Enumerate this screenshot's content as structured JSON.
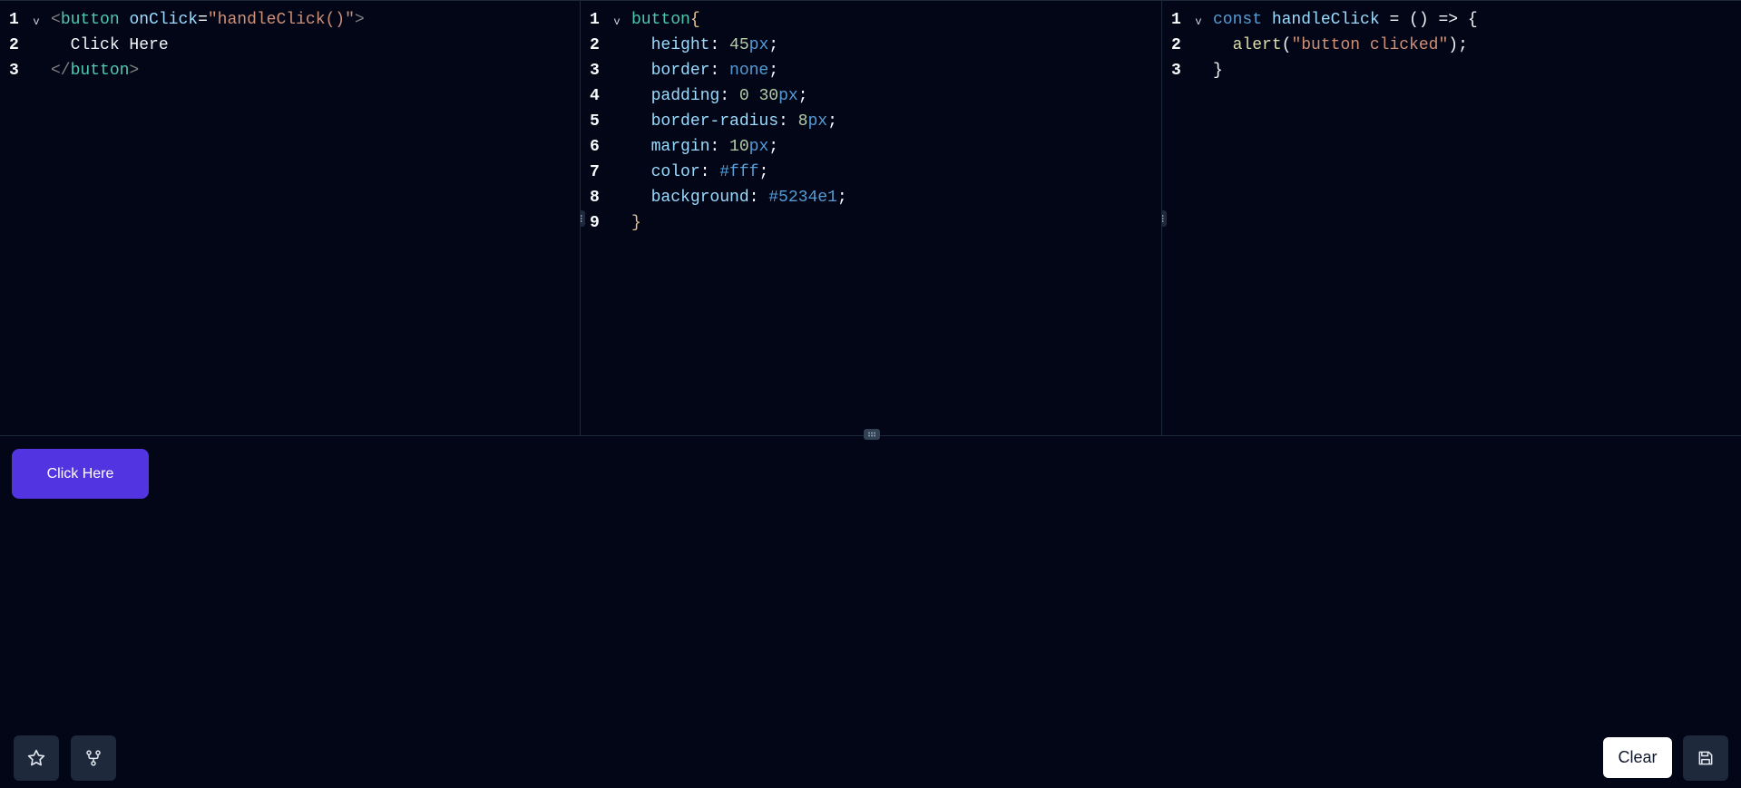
{
  "editors": {
    "html": {
      "line_numbers": [
        "1",
        "2",
        "3"
      ],
      "line1": {
        "open": "<",
        "tag": "button",
        "attr": "onClick",
        "eq": "=",
        "value": "\"handleClick()\"",
        "close": ">"
      },
      "line2": {
        "text": "Click Here"
      },
      "line3": {
        "open": "</",
        "tag": "button",
        "close": ">"
      }
    },
    "css": {
      "line_numbers": [
        "1",
        "2",
        "3",
        "4",
        "5",
        "6",
        "7",
        "8",
        "9"
      ],
      "selector": "button",
      "open_brace": "{",
      "close_brace": "}",
      "declarations": [
        {
          "prop": "height",
          "num": "45",
          "unit": "px",
          "kw": ""
        },
        {
          "prop": "border",
          "num": "",
          "unit": "",
          "kw": "none"
        },
        {
          "prop": "padding",
          "num": "0 30",
          "unit": "px",
          "kw": ""
        },
        {
          "prop": "border-radius",
          "num": "8",
          "unit": "px",
          "kw": ""
        },
        {
          "prop": "margin",
          "num": "10",
          "unit": "px",
          "kw": ""
        },
        {
          "prop": "color",
          "num": "",
          "unit": "",
          "kw": "#fff"
        },
        {
          "prop": "background",
          "num": "",
          "unit": "",
          "kw": "#5234e1"
        }
      ]
    },
    "js": {
      "line_numbers": [
        "1",
        "2",
        "3"
      ],
      "line1": {
        "kw": "const",
        "name": "handleClick",
        "rest": " = () => {"
      },
      "line2": {
        "fn": "alert",
        "open": "(",
        "str": "\"button clicked\"",
        "close": ");"
      },
      "line3": {
        "text": "}"
      }
    }
  },
  "preview": {
    "button_label": "Click Here",
    "button_color": "#5234e1"
  },
  "toolbar": {
    "star_icon": "star-icon",
    "fork_icon": "fork-icon",
    "clear_label": "Clear",
    "save_icon": "save-icon"
  },
  "colors": {
    "background": "#020617",
    "panel_border": "#1e293b",
    "button_surface": "#1e293b"
  }
}
